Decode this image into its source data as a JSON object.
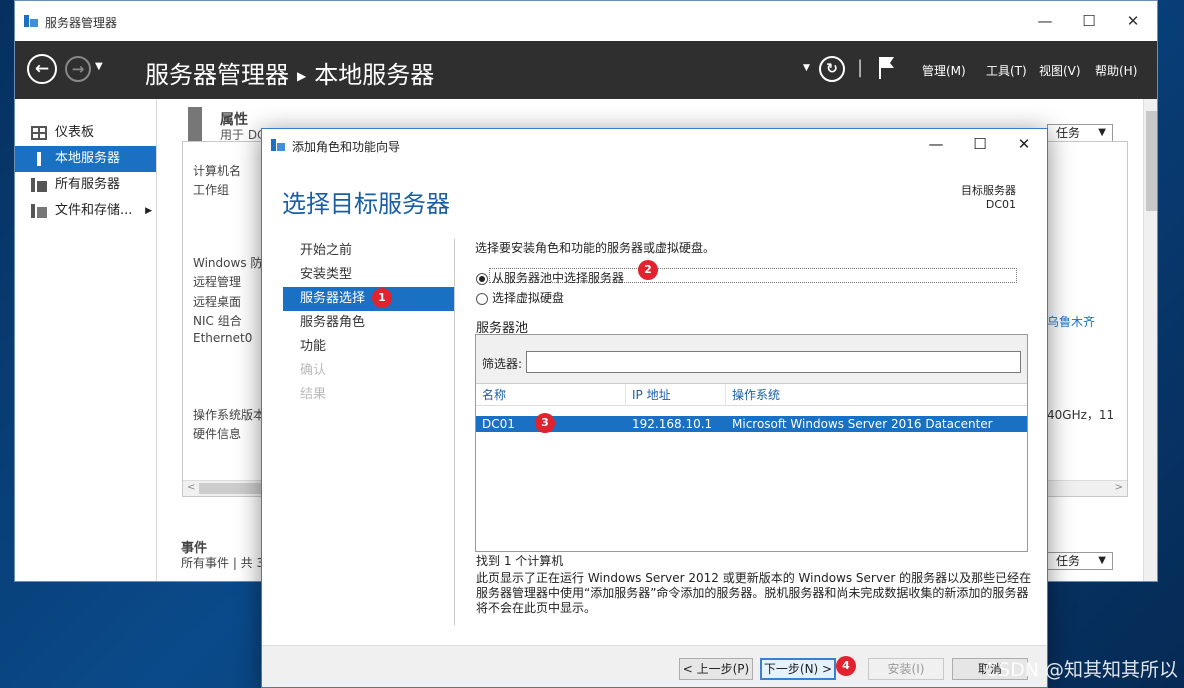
{
  "main_window": {
    "title": "服务器管理器",
    "breadcrumb": {
      "app": "服务器管理器",
      "page": "本地服务器"
    },
    "header_menus": [
      "管理(M)",
      "工具(T)",
      "视图(V)",
      "帮助(H)"
    ],
    "sidebar": [
      {
        "label": "仪表板",
        "icon": "dashboard-icon"
      },
      {
        "label": "本地服务器",
        "icon": "server-icon"
      },
      {
        "label": "所有服务器",
        "icon": "servers-icon"
      },
      {
        "label": "文件和存储...",
        "icon": "storage-icon"
      }
    ],
    "properties": {
      "title": "属性",
      "subtitle": "用于 DC",
      "labels": [
        "计算机名",
        "工作组",
        "Windows 防",
        "远程管理",
        "远程桌面",
        "NIC 组合",
        "Ethernet0",
        "操作系统版本",
        "硬件信息"
      ],
      "right_text_1": "乌鲁木齐",
      "right_text_2": "40GHz，11"
    },
    "events": {
      "title": "事件",
      "subtitle": "所有事件 | 共 3"
    },
    "tasks_label": "任务"
  },
  "dialog": {
    "title": "添加角色和功能向导",
    "heading": "选择目标服务器",
    "target_label": "目标服务器",
    "target_value": "DC01",
    "steps": [
      {
        "label": "开始之前",
        "state": "normal"
      },
      {
        "label": "安装类型",
        "state": "normal"
      },
      {
        "label": "服务器选择",
        "state": "active"
      },
      {
        "label": "服务器角色",
        "state": "normal"
      },
      {
        "label": "功能",
        "state": "normal"
      },
      {
        "label": "确认",
        "state": "disabled"
      },
      {
        "label": "结果",
        "state": "disabled"
      }
    ],
    "description": "选择要安装角色和功能的服务器或虚拟硬盘。",
    "radio_pool": "从服务器池中选择服务器",
    "radio_vhd": "选择虚拟硬盘",
    "pool_title": "服务器池",
    "filter_label": "筛选器:",
    "filter_value": "",
    "columns": [
      "名称",
      "IP 地址",
      "操作系统"
    ],
    "server": {
      "name": "DC01",
      "ip": "192.168.10.1",
      "os": "Microsoft Windows Server 2016 Datacenter"
    },
    "found_count": "找到 1 个计算机",
    "note": "此页显示了正在运行 Windows Server 2012 或更新版本的 Windows Server 的服务器以及那些已经在服务器管理器中使用“添加服务器”命令添加的服务器。脱机服务器和尚未完成数据收集的新添加的服务器将不会在此页中显示。",
    "buttons": {
      "prev": "< 上一步(P)",
      "next": "下一步(N) >",
      "install": "安装(I)",
      "cancel": "取消"
    }
  },
  "annotations": [
    "1",
    "2",
    "3",
    "4"
  ],
  "watermark": "CSDN @知其知其所以",
  "colors": {
    "accent": "#1a70c3",
    "header_bg": "#2f2f2f",
    "badge": "#e0232e",
    "heading": "#1a5fa6"
  }
}
